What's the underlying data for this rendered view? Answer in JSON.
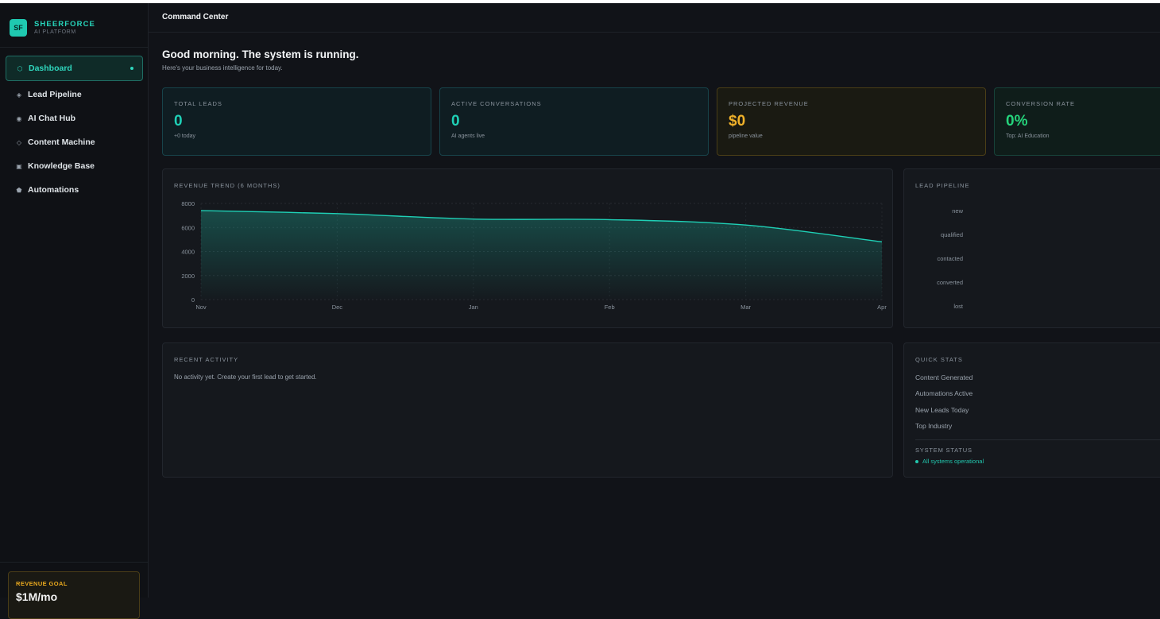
{
  "brand": {
    "logo": "SF",
    "name": "SHEERFORCE",
    "subtitle": "AI PLATFORM"
  },
  "nav": [
    {
      "label": "Dashboard",
      "icon": "hexagon-icon",
      "glyph": "⬡",
      "active": true
    },
    {
      "label": "Lead Pipeline",
      "icon": "diamond-icon",
      "glyph": "◈",
      "active": false
    },
    {
      "label": "AI Chat Hub",
      "icon": "target-icon",
      "glyph": "◉",
      "active": false
    },
    {
      "label": "Content Machine",
      "icon": "diamond-outline-icon",
      "glyph": "◇",
      "active": false
    },
    {
      "label": "Knowledge Base",
      "icon": "square-icon",
      "glyph": "▣",
      "active": false
    },
    {
      "label": "Automations",
      "icon": "pentagon-icon",
      "glyph": "⬟",
      "active": false
    }
  ],
  "goal": {
    "label": "REVENUE GOAL",
    "value": "$1M/mo"
  },
  "header": {
    "title": "Command Center"
  },
  "greeting": {
    "title": "Good morning. The system is running.",
    "subtitle": "Here's your business intelligence for today."
  },
  "kpis": [
    {
      "label": "TOTAL LEADS",
      "value": "0",
      "note": "+0 today",
      "tone": "teal"
    },
    {
      "label": "ACTIVE CONVERSATIONS",
      "value": "0",
      "note": "AI agents live",
      "tone": "teal"
    },
    {
      "label": "PROJECTED REVENUE",
      "value": "$0",
      "note": "pipeline value",
      "tone": "gold"
    },
    {
      "label": "CONVERSION RATE",
      "value": "0%",
      "note": "Top: AI Education",
      "tone": "green"
    }
  ],
  "colors": {
    "accent": "#1fd0b6",
    "gold": "#f0b12a",
    "green": "#25d47c"
  },
  "chart_data": {
    "type": "area",
    "title": "REVENUE TREND (6 MONTHS)",
    "categories": [
      "Nov",
      "Dec",
      "Jan",
      "Feb",
      "Mar",
      "Apr"
    ],
    "series": [
      {
        "values": [
          7400,
          7150,
          6700,
          6650,
          6200,
          4800
        ]
      }
    ],
    "y_ticks": [
      0,
      2000,
      4000,
      6000,
      8000
    ],
    "ylim": [
      0,
      8000
    ],
    "grid": true,
    "legend": "none"
  },
  "pipeline": {
    "title": "LEAD PIPELINE",
    "stages": [
      "new",
      "qualified",
      "contacted",
      "converted",
      "lost"
    ]
  },
  "activity": {
    "title": "RECENT ACTIVITY",
    "empty": "No activity yet. Create your first lead to get started."
  },
  "quick_stats": {
    "title": "QUICK STATS",
    "items": [
      "Content Generated",
      "Automations Active",
      "New Leads Today",
      "Top Industry"
    ],
    "system_label": "SYSTEM STATUS",
    "system_status": "All systems operational"
  }
}
